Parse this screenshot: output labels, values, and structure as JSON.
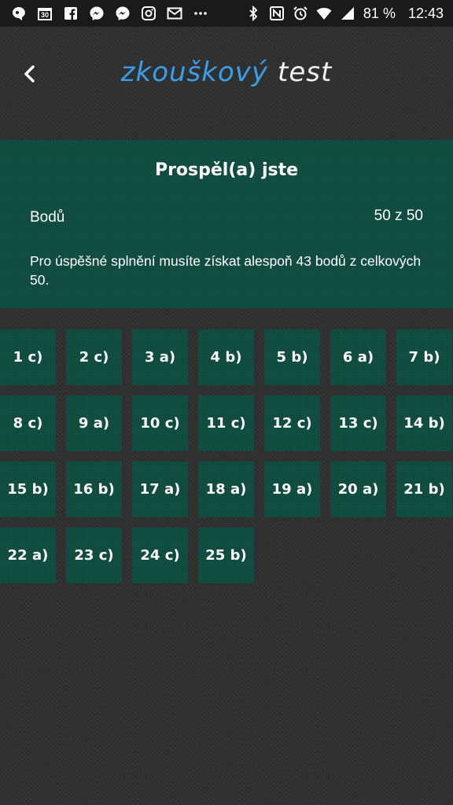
{
  "status_bar": {
    "left_icons": [
      "chat-bubble-icon",
      "calendar-icon",
      "facebook-icon",
      "messenger-icon",
      "messenger-icon",
      "instagram-icon",
      "mail-icon",
      "more-icon"
    ],
    "calendar_day": "30",
    "battery_percent": "81 %",
    "time": "12:43"
  },
  "header": {
    "title_part1": "zkouškový",
    "title_part2": "test"
  },
  "result": {
    "title": "Prospěl(a) jste",
    "points_label": "Bodů",
    "points_value": "50 z 50",
    "note": "Pro úspěšné splnění musíte získat alespoň 43 bodů z celkových 50."
  },
  "answers": [
    "1 c)",
    "2 c)",
    "3 a)",
    "4 b)",
    "5 b)",
    "6 a)",
    "7 b)",
    "8 c)",
    "9 a)",
    "10 c)",
    "11 c)",
    "12 c)",
    "13 c)",
    "14 b)",
    "15 b)",
    "16 b)",
    "17 a)",
    "18 a)",
    "19 a)",
    "20 a)",
    "21 b)",
    "22 a)",
    "23 c)",
    "24 c)",
    "25 b)"
  ],
  "colors": {
    "background": "#2e2e2e",
    "panel": "#0f4d41",
    "title_accent": "#3a9ee8",
    "status_bar": "#1a1a1a"
  }
}
